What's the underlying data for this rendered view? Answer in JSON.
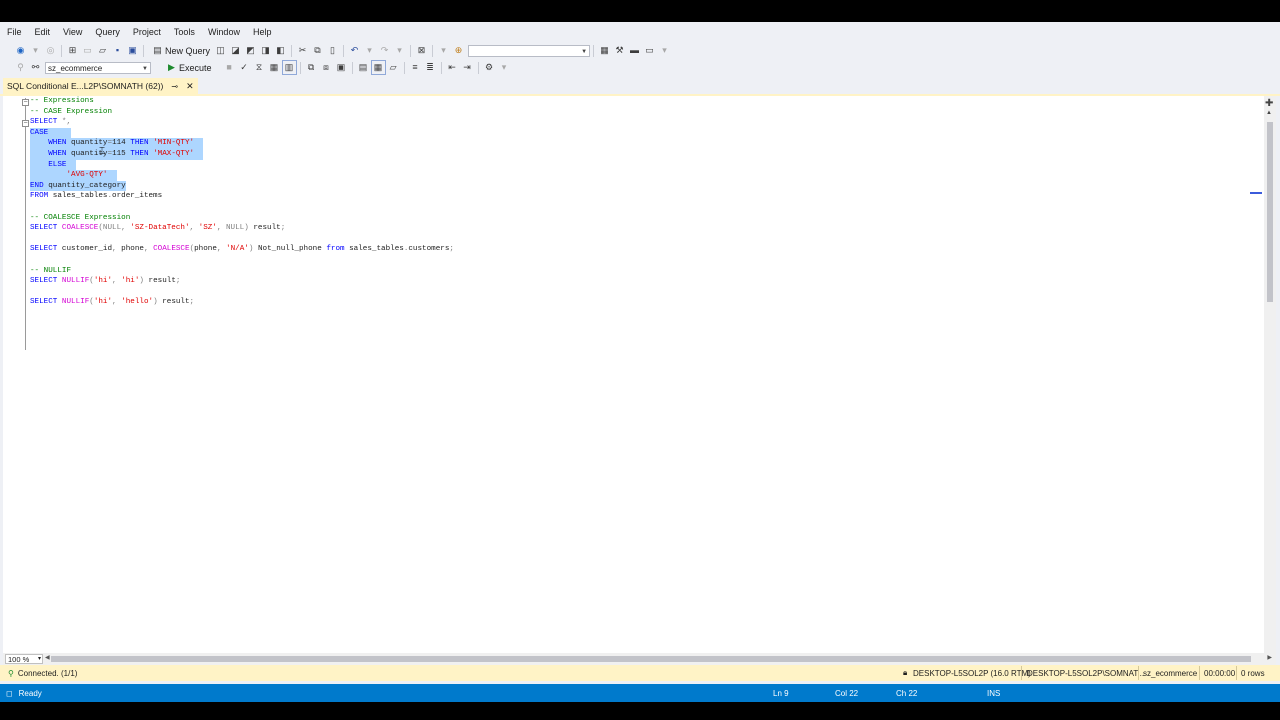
{
  "menu": [
    "File",
    "Edit",
    "View",
    "Query",
    "Project",
    "Tools",
    "Window",
    "Help"
  ],
  "toolbar": {
    "new_query_label": "New Query",
    "search_combo_value": "",
    "database_value": "sz_ecommerce",
    "execute_label": "Execute"
  },
  "tab": {
    "title": "SQL Conditional E...L2P\\SOMNATH (62))",
    "pin_icon": "pin-icon",
    "close_icon": "close-icon"
  },
  "code": [
    "-- Expressions",
    "-- CASE Expression",
    "SELECT *,",
    "CASE",
    "    WHEN quantity=114 THEN 'MIN-QTY'",
    "    WHEN quantity=115 THEN 'MAX-QTY'",
    "    ELSE",
    "        'AVG-QTY'",
    "END quantity_category",
    "FROM sales_tables.order_items",
    "",
    "-- COALESCE Expression",
    "SELECT COALESCE(NULL, 'SZ-DataTech', 'SZ', NULL) result;",
    "",
    "SELECT customer_id, phone, COALESCE(phone, 'N/A') Not_null_phone from sales_tables.customers;",
    "",
    "-- NULLIF",
    "SELECT NULLIF('hi', 'hi') result;",
    "",
    "SELECT NULLIF('hi', 'hello') result;"
  ],
  "zoom": "100 %",
  "query_status": {
    "connected": "Connected. (1/1)",
    "server": "DESKTOP-L5SOL2P (16.0 RTM)",
    "user": "DESKTOP-L5SOL2P\\SOMNAT...",
    "database": "sz_ecommerce",
    "elapsed": "00:00:00",
    "rows": "0 rows"
  },
  "status_bar": {
    "ready": "Ready",
    "line": "Ln 9",
    "col": "Col 22",
    "ch": "Ch 22",
    "mode": "INS"
  },
  "colors": {
    "status_blue": "#007acc",
    "tab_yellow": "#fff3c6",
    "selection": "#add6ff",
    "keyword": "#0000ff",
    "string": "#e00000",
    "comment": "#008000",
    "function": "#d400d4"
  }
}
